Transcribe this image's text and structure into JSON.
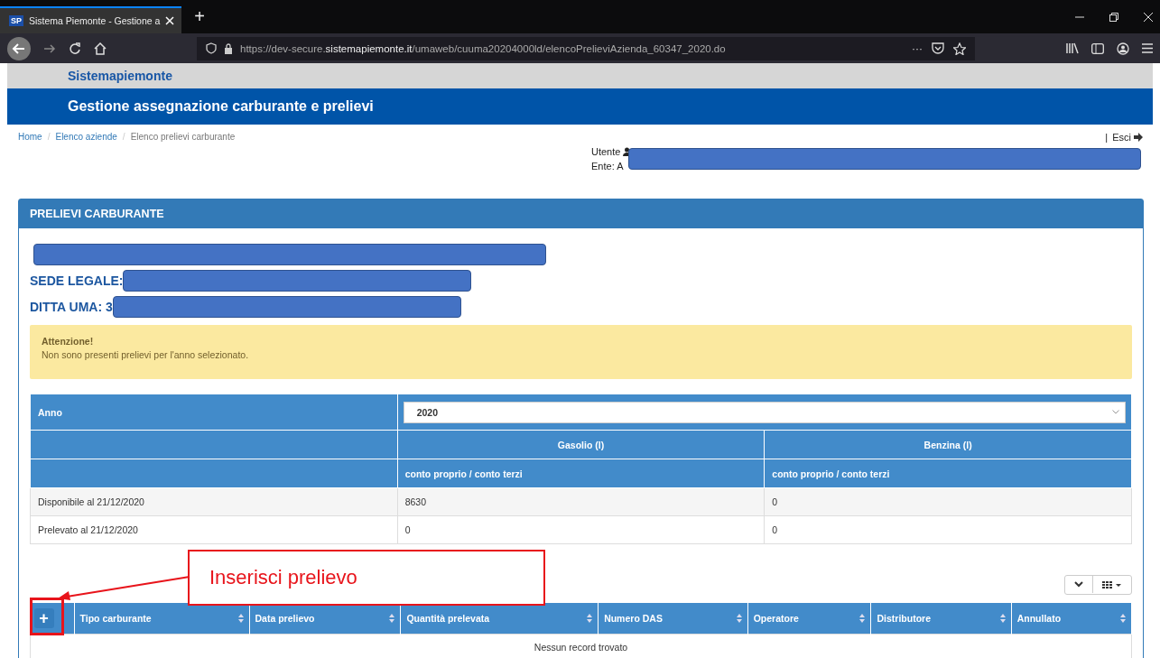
{
  "browser": {
    "tab_title": "Sistema Piemonte - Gestione a",
    "tab_logo": "SP",
    "new_tab": "+",
    "url_prefix": "https://dev-secure.",
    "url_host": "sistemapiemonte.it",
    "url_path": "/umaweb/cuuma20204000ld/elencoPrelieviAzienda_60347_2020.do",
    "more": "···"
  },
  "site": {
    "brand": "Sistemapiemonte",
    "title": "Gestione assegnazione carburante e prelievi"
  },
  "breadcrumb": [
    {
      "label": "Home",
      "link": true,
      "separator": "/"
    },
    {
      "label": "Elenco aziende",
      "link": true,
      "separator": "/"
    },
    {
      "label": "Elenco prelievi carburante",
      "link": false
    }
  ],
  "logout": {
    "separator": "|",
    "label": "Esci"
  },
  "user": {
    "user_label": "Utente",
    "ente_label": "Ente: A"
  },
  "panel": {
    "title": "PRELIEVI CARBURANTE",
    "sede_label": "SEDE LEGALE:",
    "ditta_label": "DITTA UMA: 3"
  },
  "alert": {
    "title": "Attenzione!",
    "message": "Non sono presenti prelievi per l'anno selezionato."
  },
  "summary": {
    "anno_label": "Anno",
    "anno_value": "2020",
    "fuel_headers": [
      "Gasolio (l)",
      "Benzina (l)"
    ],
    "sub_headers": [
      "conto proprio / conto terzi",
      "conto proprio / conto terzi"
    ],
    "rows": [
      {
        "label": "Disponibile al 21/12/2020",
        "values": [
          "8630",
          "0"
        ]
      },
      {
        "label": "Prelevato al 21/12/2020",
        "values": [
          "0",
          "0"
        ]
      }
    ]
  },
  "annotation": {
    "label": "Inserisci prelievo"
  },
  "records": {
    "add": "+",
    "columns": [
      "Tipo carburante",
      "Data prelievo",
      "Quantità prelevata",
      "Numero DAS",
      "Operatore",
      "Distributore",
      "Annullato"
    ],
    "empty": "Nessun record trovato"
  }
}
